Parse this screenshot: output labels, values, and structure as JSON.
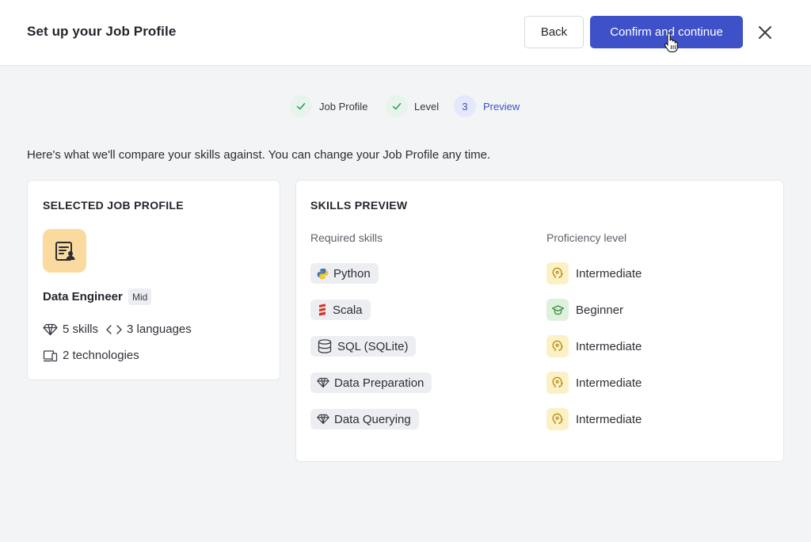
{
  "header": {
    "title": "Set up your Job Profile",
    "back_label": "Back",
    "confirm_label": "Confirm and continue"
  },
  "stepper": {
    "steps": [
      {
        "label": "Job Profile",
        "state": "done"
      },
      {
        "label": "Level",
        "state": "done"
      },
      {
        "label": "Preview",
        "state": "active",
        "number": "3"
      }
    ]
  },
  "intro": "Here's what we'll compare your skills against. You can change your Job Profile any time.",
  "selected_profile": {
    "heading": "SELECTED JOB PROFILE",
    "name": "Data Engineer",
    "level": "Mid",
    "skills_count": "5 skills",
    "languages_count": "3 languages",
    "technologies_count": "2 technologies"
  },
  "skills_preview": {
    "heading": "SKILLS PREVIEW",
    "required_header": "Required skills",
    "proficiency_header": "Proficiency level",
    "rows": [
      {
        "skill": "Python",
        "icon": "python-icon",
        "level": "Intermediate"
      },
      {
        "skill": "Scala",
        "icon": "scala-icon",
        "level": "Beginner"
      },
      {
        "skill": "SQL (SQLite)",
        "icon": "database-icon",
        "level": "Intermediate"
      },
      {
        "skill": "Data Preparation",
        "icon": "diamond-icon",
        "level": "Intermediate"
      },
      {
        "skill": "Data Querying",
        "icon": "diamond-icon",
        "level": "Intermediate"
      }
    ]
  },
  "colors": {
    "accent": "#3f51c9",
    "intermediate_bg": "#fbf1c4",
    "beginner_bg": "#ddf1dc",
    "profile_avatar_bg": "#fbdaa0"
  }
}
